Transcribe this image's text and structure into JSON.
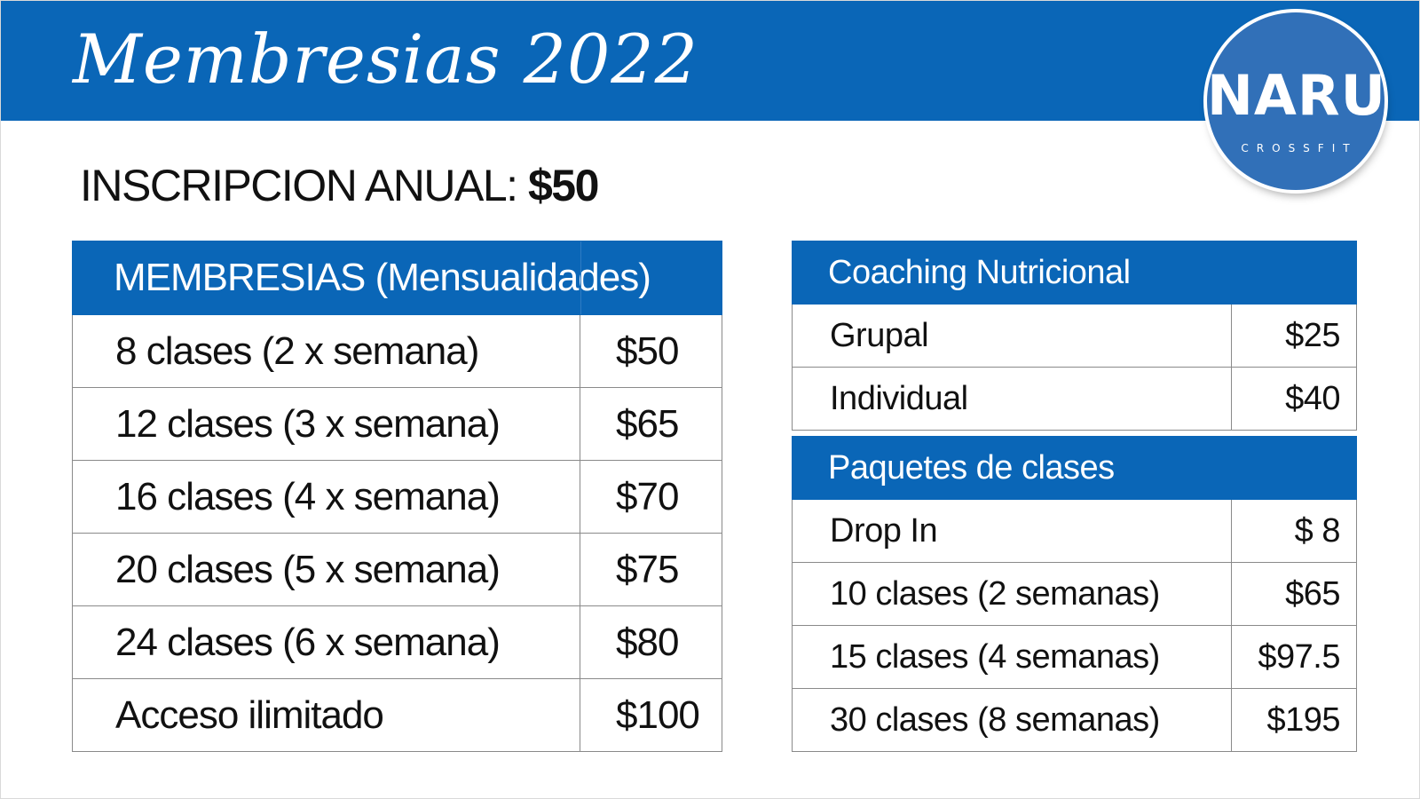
{
  "header": {
    "title": "Membresias 2022",
    "banner_color": "#0a66b7"
  },
  "logo": {
    "name": "NARU",
    "subtitle": "CROSSFIT",
    "color": "#3170b8"
  },
  "inscripcion": {
    "label": "INSCRIPCION ANUAL: ",
    "amount": "$50"
  },
  "membresias": {
    "header": "MEMBRESIAS (Mensualidades)",
    "rows": [
      {
        "label": "8 clases (2 x semana)",
        "price": "$50"
      },
      {
        "label": "12 clases (3 x semana)",
        "price": "$65"
      },
      {
        "label": "16 clases (4 x semana)",
        "price": "$70"
      },
      {
        "label": "20 clases (5 x semana)",
        "price": "$75"
      },
      {
        "label": "24 clases (6 x semana)",
        "price": "$80"
      },
      {
        "label": "Acceso ilimitado",
        "price": "$100"
      }
    ]
  },
  "coaching": {
    "header": "Coaching Nutricional",
    "rows": [
      {
        "label": "Grupal",
        "price": "$25"
      },
      {
        "label": "Individual",
        "price": "$40"
      }
    ]
  },
  "paquetes": {
    "header": "Paquetes de clases",
    "rows": [
      {
        "label": "Drop In",
        "price": "$ 8"
      },
      {
        "label": "10 clases (2 semanas)",
        "price": "$65"
      },
      {
        "label": "15 clases (4 semanas)",
        "price": "$97.5"
      },
      {
        "label": "30 clases (8 semanas)",
        "price": "$195"
      }
    ]
  }
}
